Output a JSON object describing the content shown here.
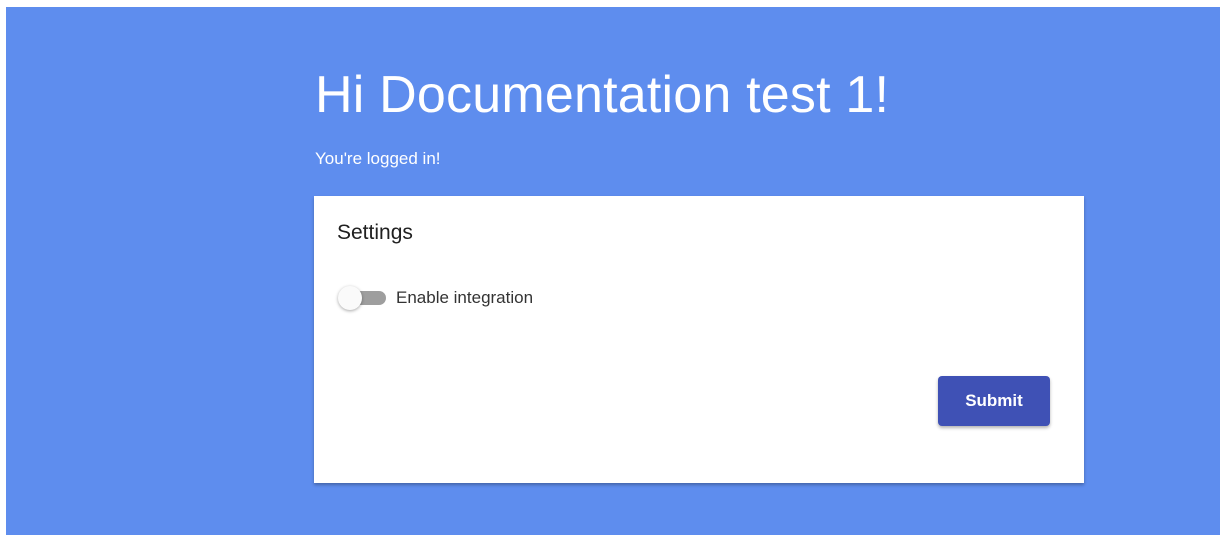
{
  "header": {
    "greeting": "Hi Documentation test 1!",
    "status": "You're logged in!"
  },
  "settings": {
    "title": "Settings",
    "toggle": {
      "label": "Enable integration",
      "enabled": false
    },
    "submit_label": "Submit"
  },
  "colors": {
    "background": "#5e8dee",
    "button": "#3f51b5",
    "toggle_track": "#9e9e9e"
  }
}
